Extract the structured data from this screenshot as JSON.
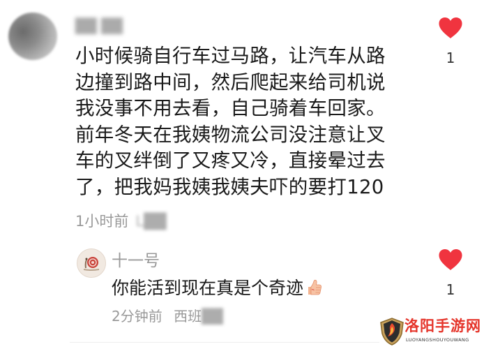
{
  "colors": {
    "heart": "#f0343f",
    "text_primary": "#1a1a1a",
    "text_secondary": "#999999",
    "watermark_red": "#e5352b"
  },
  "main_comment": {
    "username": "██ ██",
    "lines": [
      "小时候骑自行车过马路，让汽车从路",
      "边撞到路中间，然后爬起来给司机说",
      "我没事不用去看，自己骑着车回家。",
      "前年冬天在我姨物流公司没注意让叉",
      "车的叉绊倒了又疼又冷，直接晕过去",
      "了，把我妈我姨我姨夫吓的要打120"
    ],
    "time": "1小时前",
    "location": "L██",
    "like_icon": "heart-icon",
    "like_count": "1"
  },
  "reply": {
    "username": "十一号",
    "text": "你能活到现在真是个奇迹",
    "emoji": "thumbs-up-icon",
    "time": "2分钟前",
    "location_prefix": "西班",
    "location_blur": "██",
    "like_icon": "heart-icon",
    "like_count": "1"
  },
  "watermark": {
    "title": "洛阳手游网",
    "subtitle": "LUOYANGSHOUYOUWANG"
  }
}
